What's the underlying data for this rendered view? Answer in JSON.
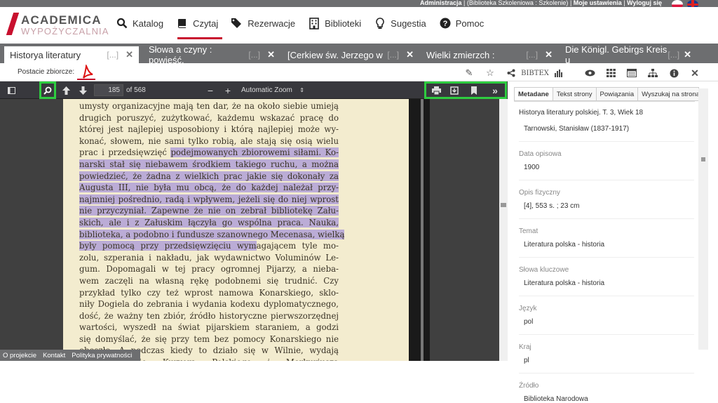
{
  "topbar": {
    "admin": "Administracja",
    "library": "(Biblioteka Szkoleniowa : Szkolenie)",
    "settings": "Moje ustawienia",
    "logout": "Wyloguj się"
  },
  "logo": {
    "line1": "ACADEMICA",
    "line2": "WYPOŻYCZALNIA"
  },
  "nav": [
    {
      "label": "Katalog",
      "icon": "search-icon"
    },
    {
      "label": "Czytaj",
      "icon": "book-icon"
    },
    {
      "label": "Rezerwacje",
      "icon": "tags-icon"
    },
    {
      "label": "Biblioteki",
      "icon": "building-icon"
    },
    {
      "label": "Sugestia",
      "icon": "lightbulb-icon"
    },
    {
      "label": "Pomoc",
      "icon": "help-icon"
    }
  ],
  "tabs": [
    {
      "label": "Historya literatury",
      "dots": "[...]"
    },
    {
      "label": "Słowa a czyny : powieść.",
      "dots": "[...]"
    },
    {
      "label": "[Cerkiew św. Jerzego w",
      "dots": "[...]"
    },
    {
      "label": "Wielki zmierzch :",
      "dots": "[...]"
    },
    {
      "label": "Die Königl. Gebirgs Kreis u",
      "dots": "[...]"
    }
  ],
  "toolbar": {
    "forms_label": "Postacie zbiorcze:",
    "bibtex": "BIBTEX"
  },
  "viewer": {
    "page": "185",
    "of": "of 568",
    "zoom": "Automatic Zoom"
  },
  "page_text": [
    {
      "t": "umysty organizacyjne mają ten dar, że na około siebie umieją",
      "hl": ""
    },
    {
      "t": "drugich poruszyć, zużytkować, każdemu wskazać pracę do",
      "hl": ""
    },
    {
      "t": "której jest najlepiej usposobiony i którą najlepiej może wy-",
      "hl": ""
    },
    {
      "t": "konać, słowem, nie sami tylko robią, ale stają się osią wielu",
      "hl": ""
    },
    {
      "t": "prac i przedsięwzięć ",
      "hl": "podejmowanych zbiorowemi siłami. Ko-"
    },
    {
      "t": "",
      "hl": "narski stał się niebawem środkiem takiego ruchu, a można"
    },
    {
      "t": "",
      "hl": "powiedzieć, że żadna z wielkich prac jakie się dokonały za"
    },
    {
      "t": "",
      "hl": "Augusta III, nie była mu obcą, że do każdej należał przy-"
    },
    {
      "t": "",
      "hl": "najmniej pośrednio, radą i wpływem, jeżeli się do niej wprost"
    },
    {
      "t": "",
      "hl": "nie przyczyniał. Zapewne że nie on zebrał bibliotekę Zału-"
    },
    {
      "t": "",
      "hl": "skich, ale i z Załuskim łączyła go wspólna praca. Nauka,"
    },
    {
      "t": "",
      "hl": "biblioteka, a podobno i fundusze szanownego Mecenasa, wielką"
    },
    {
      "t": "",
      "hl": "były pomocą przy przedsięwzięciu wym",
      "rest": "agającem tyle mo-"
    },
    {
      "t": "zolu, szperania i nakładu, jak wydawnictwo Voluminów Le-",
      "hl": ""
    },
    {
      "t": "gum. Dopomagali w tej pracy ogromnej Pijarzy, a nieba-",
      "hl": ""
    },
    {
      "t": "wem zaczęli na własną rękę podobnemi się trudnić. Czy",
      "hl": ""
    },
    {
      "t": "przykład tylko czy też wprost namowa Konarskiego, sklo-",
      "hl": ""
    },
    {
      "t": "niły Dogiela do zebrania i wydania kodexu dyplomatycznego,",
      "hl": ""
    },
    {
      "t": "dość, że ważny ten zbiór, źródło historyczne pierwszorzędnej",
      "hl": ""
    },
    {
      "t": "wartości, wyszedł na świat pijarskiem staraniem, a godzi",
      "hl": ""
    },
    {
      "t": "się domyślać, że się przy tem bez pomocy Konarskiego nie",
      "hl": ""
    },
    {
      "t": "obeszło. A podczas kiedy to działo się w Wilnie, wydają",
      "hl": ""
    },
    {
      "t": "w Warszawie Kuryera Polskiego i Merkuriusza",
      "hl": ""
    }
  ],
  "sidebar": {
    "tabs": [
      "Metadane",
      "Tekst strony",
      "Powiązania",
      "Wyszukaj na stronac"
    ],
    "title": "Historya literatury polskiej. T. 3, Wiek 18",
    "author": "Tarnowski, Stanisław (1837-1917)",
    "fields": [
      {
        "label": "Data opisowa",
        "value": "1900"
      },
      {
        "label": "Opis fizyczny",
        "value": "[4], 553 s. ; 23 cm"
      },
      {
        "label": "Temat",
        "value": "Literatura polska - historia"
      },
      {
        "label": "Słowa kluczowe",
        "value": "Literatura polska - historia"
      },
      {
        "label": "Język",
        "value": "pol"
      },
      {
        "label": "Kraj",
        "value": "pl"
      },
      {
        "label": "Źródło",
        "value": "Biblioteka Narodowa"
      }
    ]
  },
  "footer": {
    "about": "O projekcie",
    "contact": "Kontakt",
    "privacy": "Polityka prywatności"
  }
}
